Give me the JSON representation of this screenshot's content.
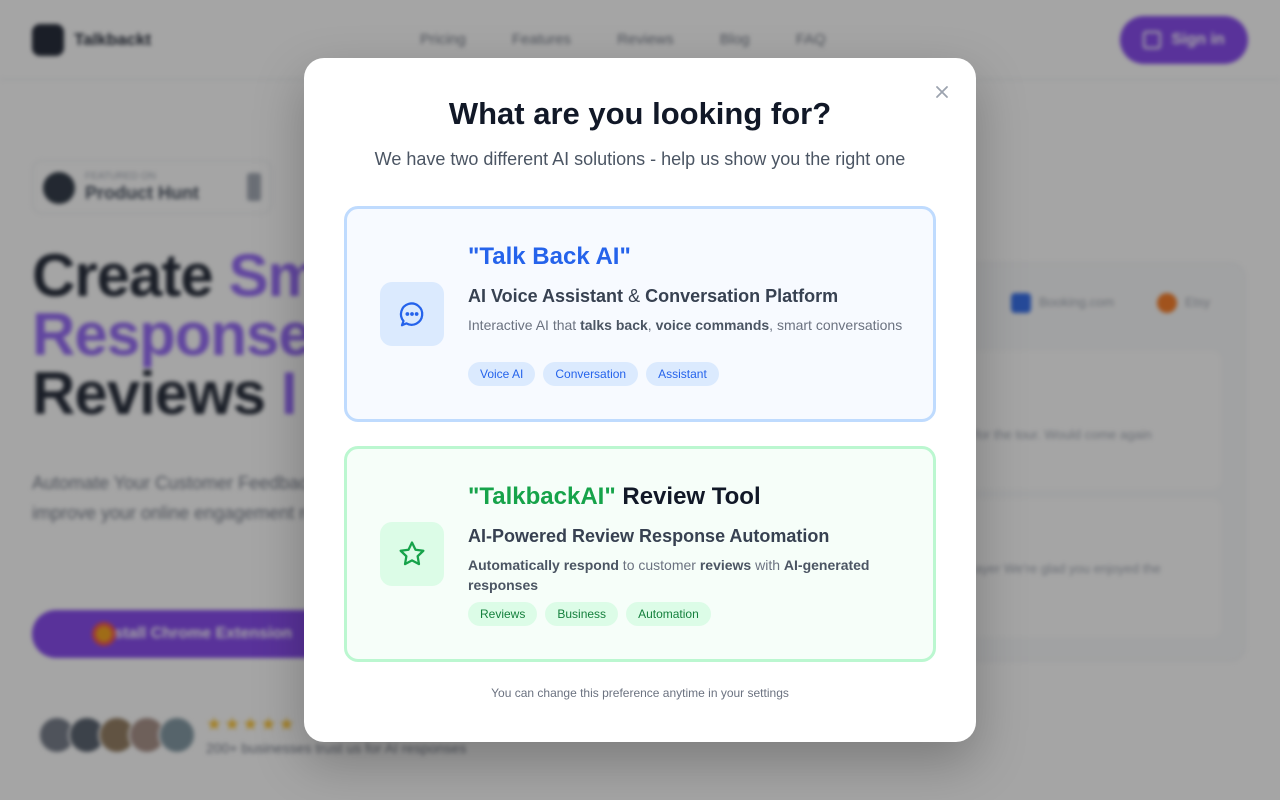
{
  "background": {
    "logo_text": "Talkbackt",
    "nav_links": [
      "Pricing",
      "Features",
      "Reviews",
      "Blog",
      "FAQ"
    ],
    "signin_label": "Sign in",
    "badge_small": "FEATURED ON",
    "badge_big": "Product Hunt",
    "hero_line1_dark": "Create ",
    "hero_line1_purple": "Sm",
    "hero_line2_purple": "Response",
    "hero_line3_dark": "Reviews ",
    "hero_line3_purple": "I",
    "hero_subtitle": "Automate Your Customer Feedback. Save time and improve your online engagement review responses.",
    "cta_label": "Install Chrome Extension",
    "stars": "★★★★★",
    "rating_text": "200+ businesses trust us for AI responses",
    "panel_pill1": "Booking.com",
    "panel_pill2": "Etsy",
    "panel_card1_text": "for the tour. Would come again",
    "panel_card2_text": "ayer We're glad you enjoyed the"
  },
  "modal": {
    "title": "What are you looking for?",
    "subtitle": "We have two different AI solutions - help us show you the right one",
    "footer": "You can change this preference anytime in your settings",
    "option1": {
      "title": "\"Talk Back AI\"",
      "heading_part1": "AI Voice Assistant",
      "heading_amp": " & ",
      "heading_part2": "Conversation Platform",
      "desc_1": "Interactive AI that ",
      "desc_b1": "talks back",
      "desc_2": ", ",
      "desc_b2": "voice commands",
      "desc_3": ", smart conversations",
      "tags": [
        "Voice AI",
        "Conversation",
        "Assistant"
      ],
      "icon": "chat-bubble-icon",
      "color": "#2563eb"
    },
    "option2": {
      "title_quoted": "\"TalkbackAI\"",
      "title_rest": " Review Tool",
      "heading": "AI-Powered Review Response Automation",
      "desc_b1": "Automatically respond",
      "desc_1": " to customer ",
      "desc_b2": "reviews",
      "desc_2": " with ",
      "desc_b3": "AI-generated responses",
      "tags": [
        "Reviews",
        "Business",
        "Automation"
      ],
      "icon": "star-icon",
      "color": "#16a34a"
    }
  }
}
